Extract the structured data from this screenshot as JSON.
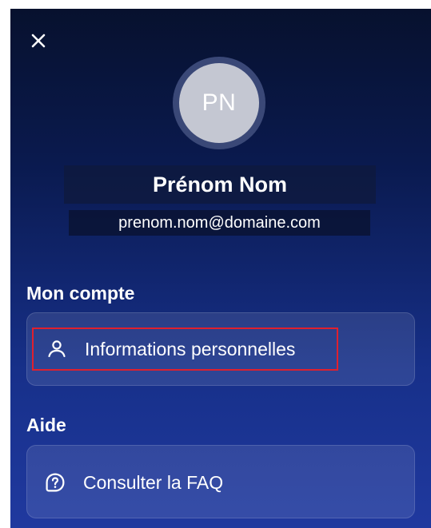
{
  "header": {
    "close_icon": "close-icon"
  },
  "profile": {
    "initials": "PN",
    "name": "Prénom Nom",
    "email": "prenom.nom@domaine.com"
  },
  "sections": [
    {
      "title": "Mon compte",
      "items": [
        {
          "label": "Informations personnelles",
          "icon": "person-icon",
          "highlighted": true
        }
      ]
    },
    {
      "title": "Aide",
      "items": [
        {
          "label": "Consulter la FAQ",
          "icon": "question-circle-icon",
          "highlighted": false
        }
      ]
    }
  ],
  "colors": {
    "highlight": "#e0202e",
    "avatar_bg": "#c4c7d2",
    "panel_top": "#07112e",
    "panel_bottom": "#20399f"
  }
}
